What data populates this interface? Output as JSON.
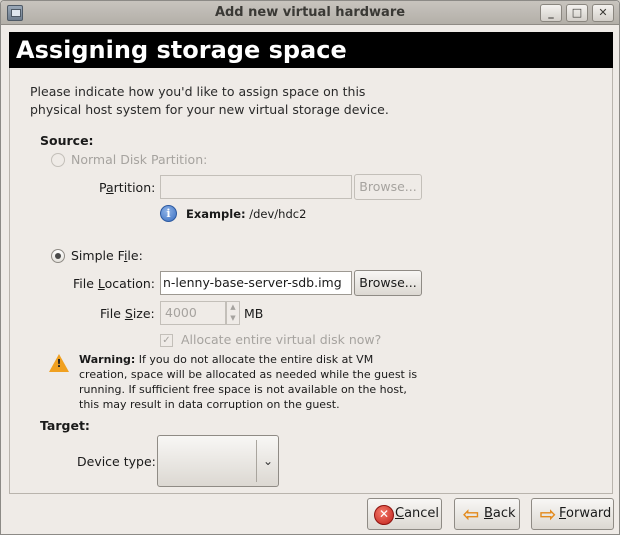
{
  "window": {
    "title": "Add new virtual hardware",
    "minimize_glyph": "_",
    "maximize_glyph": "□",
    "close_glyph": "✕"
  },
  "header": {
    "title": "Assigning storage space"
  },
  "intro": "Please indicate how you'd like to assign space on this physical host system for your new virtual storage device.",
  "source": {
    "label": "Source:",
    "partition_option": {
      "label": "Normal Disk Partition:",
      "selected": false,
      "enabled": false
    },
    "partition": {
      "label_pre": "P",
      "label_underlined": "a",
      "label_post": "rtition:",
      "value": "",
      "browse_label": "Browse...",
      "example_label": "Example:",
      "example_value": "/dev/hdc2"
    },
    "file_option": {
      "label_pre": "Simple F",
      "label_underlined": "i",
      "label_post": "le:",
      "selected": true,
      "enabled": true
    },
    "file_location": {
      "label_pre": "File ",
      "label_underlined": "L",
      "label_post": "ocation:",
      "value": "n-lenny-base-server-sdb.img",
      "browse_label": "Browse..."
    },
    "file_size": {
      "label_pre": "File ",
      "label_underlined": "S",
      "label_post": "ize:",
      "value": "4000",
      "unit": "MB"
    },
    "allocate": {
      "label": "Allocate entire virtual disk now?",
      "checked": true,
      "enabled": false
    },
    "warning": {
      "title": "Warning:",
      "text": "If you do not allocate the entire disk at VM creation, space will be allocated as needed while the guest is running. If sufficient free space is not available on the host, this may result in data corruption on the guest."
    }
  },
  "target": {
    "label": "Target:",
    "device_type_label": "Device type:",
    "device_type_value": ""
  },
  "buttons": {
    "cancel": {
      "label_underlined": "C",
      "label_post": "ancel",
      "icon_glyph": "✕"
    },
    "back": {
      "label_underlined": "B",
      "label_post": "ack",
      "icon_glyph": "⇦"
    },
    "forward": {
      "label_underlined": "F",
      "label_post": "orward",
      "icon_glyph": "⇨"
    }
  },
  "colors": {
    "banner_bg": "#000000",
    "banner_text": "#ffffff",
    "window_bg": "#efebe7",
    "disabled_text": "#a6a39f",
    "warning_orange": "#f0a020",
    "info_blue": "#3a6fc2",
    "cancel_red": "#c0201a"
  }
}
